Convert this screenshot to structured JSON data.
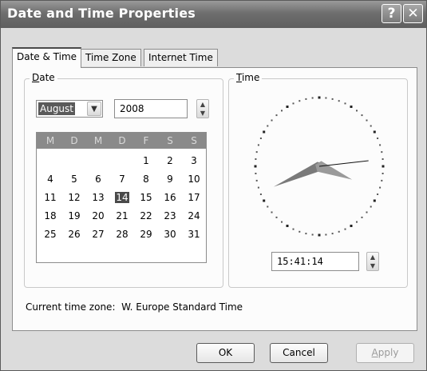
{
  "window": {
    "title": "Date and Time Properties",
    "help_glyph": "?",
    "close_glyph": "✕"
  },
  "tabs": [
    {
      "label": "Date & Time",
      "active": true
    },
    {
      "label": "Time Zone",
      "active": false
    },
    {
      "label": "Internet Time",
      "active": false
    }
  ],
  "date_group": {
    "label_first": "D",
    "label_rest": "ate",
    "month": "August",
    "year": "2008",
    "weekday_headers": [
      "M",
      "D",
      "M",
      "D",
      "F",
      "S",
      "S"
    ],
    "weeks": [
      [
        "",
        "",
        "",
        "",
        "1",
        "2",
        "3"
      ],
      [
        "4",
        "5",
        "6",
        "7",
        "8",
        "9",
        "10"
      ],
      [
        "11",
        "12",
        "13",
        "14",
        "15",
        "16",
        "17"
      ],
      [
        "18",
        "19",
        "20",
        "21",
        "22",
        "23",
        "24"
      ],
      [
        "25",
        "26",
        "27",
        "28",
        "29",
        "30",
        "31"
      ]
    ],
    "selected_day": "14"
  },
  "time_group": {
    "label_first": "T",
    "label_rest": "ime",
    "time_value": "15:41:14",
    "clock": {
      "hour": 15,
      "minute": 41,
      "second": 14
    }
  },
  "status": {
    "label": "Current time zone:",
    "value": "W. Europe Standard Time"
  },
  "buttons": {
    "ok": "OK",
    "cancel": "Cancel",
    "apply_first": "A",
    "apply_rest": "pply"
  },
  "colors": {
    "selected_day_bg": "#4a4a4a",
    "calendar_header_bg": "#8a8a8a",
    "hour_hand": "#9a9a9a",
    "minute_hand": "#7a7a7a"
  }
}
